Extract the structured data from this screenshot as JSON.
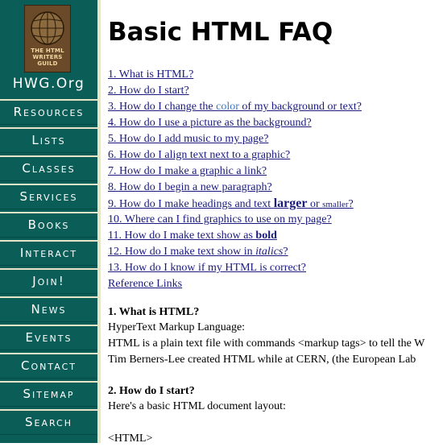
{
  "logo": {
    "text_lines": [
      "THE HTML",
      "WRITERS",
      "GUILD"
    ],
    "site_name": "HWG.Org"
  },
  "nav": [
    "Resources",
    "Lists",
    "Classes",
    "Services",
    "Books",
    "Interact",
    "Join!",
    "News",
    "Events",
    "Contact",
    "Sitemap",
    "Search"
  ],
  "page": {
    "title": "Basic HTML FAQ"
  },
  "faq": {
    "q1": "1. What is HTML?",
    "q2": "2. How do I start?",
    "q3_pre": "3. How do I change the ",
    "q3_color": "color",
    "q3_post": " of my background or text?",
    "q4": "4. How do I use a picture as the background?",
    "q5": "5. How do I add music to my page?",
    "q6": "6. How do I align text next to a graphic?",
    "q7": "7. How do I make a graphic a link?",
    "q8": "8. How do I begin a new paragraph?",
    "q9_pre": "9. How do I make headings and text ",
    "q9_larger": "larger",
    "q9_mid": " or ",
    "q9_smaller": "smaller",
    "q9_post": "?",
    "q10": "10. Where can I find graphics to use on my page?",
    "q11_pre": "11. How do I make text show as ",
    "q11_bold": "bold",
    "q12_pre": "12. How do I make text show in ",
    "q12_italics": "italics",
    "q12_post": "?",
    "q13": "13. How do I know if my HTML is correct?",
    "ref": "Reference Links"
  },
  "sections": {
    "s1_title": "1. What is HTML?",
    "s1_p1": "HyperText Markup Language:",
    "s1_p2": "HTML is a plain text file with commands <markup tags> to tell the W",
    "s1_p3": "Tim Berners-Lee created HTML while at CERN, (the European Lab",
    "s2_title": "2. How do I start?",
    "s2_p1": "Here's a basic HTML document layout:",
    "s2_code": "<HTML>"
  },
  "colors": {
    "sidebar": "#0b5e57",
    "strip": "#e8e4c8",
    "link": "#1a1a7e",
    "color_word": "#3b78c8"
  },
  "icons": {
    "logo": "globe-icon"
  }
}
